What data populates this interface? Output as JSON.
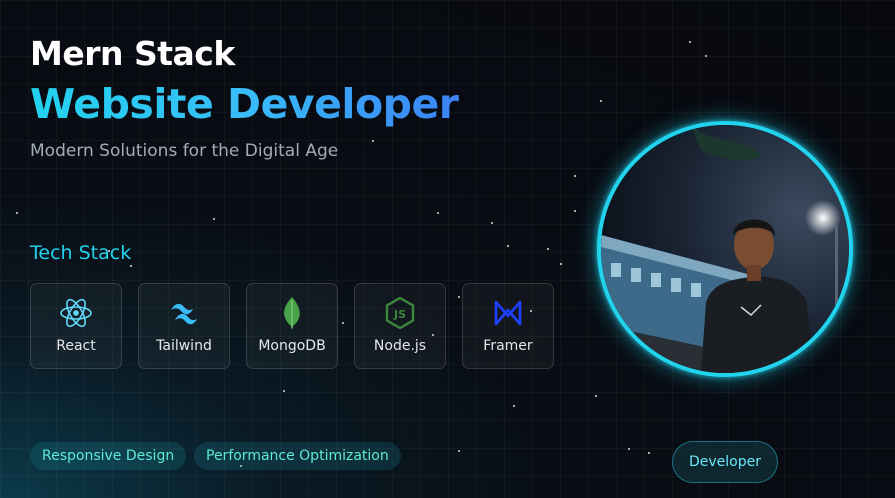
{
  "hero": {
    "title_line1": "Mern Stack",
    "title_line2": "Website Developer",
    "subtitle": "Modern Solutions for the Digital Age"
  },
  "tech_stack": {
    "heading": "Tech Stack",
    "items": [
      {
        "label": "React",
        "icon": "react-icon",
        "color": "#61dafb"
      },
      {
        "label": "Tailwind",
        "icon": "tailwind-icon",
        "color": "#38bdf8"
      },
      {
        "label": "MongoDB",
        "icon": "mongodb-icon",
        "color": "#47a248"
      },
      {
        "label": "Node.js",
        "icon": "nodejs-icon",
        "color": "#3c873a"
      },
      {
        "label": "Framer",
        "icon": "framer-icon",
        "color": "#1e40ff"
      }
    ]
  },
  "tags": [
    "Responsive Design",
    "Performance Optimization"
  ],
  "profile": {
    "badge": "Developer",
    "photo": "profile-photo"
  },
  "colors": {
    "accent": "#22d3ee",
    "background": "#07090e"
  }
}
